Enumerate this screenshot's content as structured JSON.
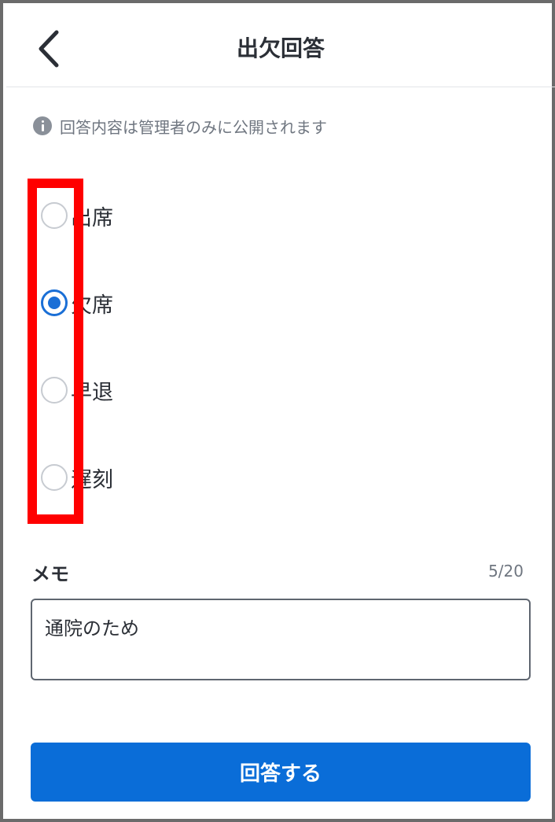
{
  "header": {
    "title": "出欠回答",
    "back_icon": "chevron-left-icon"
  },
  "notice": {
    "icon": "info-icon",
    "text": "回答内容は管理者のみに公開されます"
  },
  "attendance": {
    "options": [
      {
        "label": "出席",
        "selected": false
      },
      {
        "label": "欠席",
        "selected": true
      },
      {
        "label": "早退",
        "selected": false
      },
      {
        "label": "遅刻",
        "selected": false
      }
    ]
  },
  "memo": {
    "label": "メモ",
    "count": "5/20",
    "value": "通院のため"
  },
  "submit": {
    "label": "回答する"
  },
  "colors": {
    "accent": "#0a6dd8",
    "highlight": "#ff0000"
  }
}
